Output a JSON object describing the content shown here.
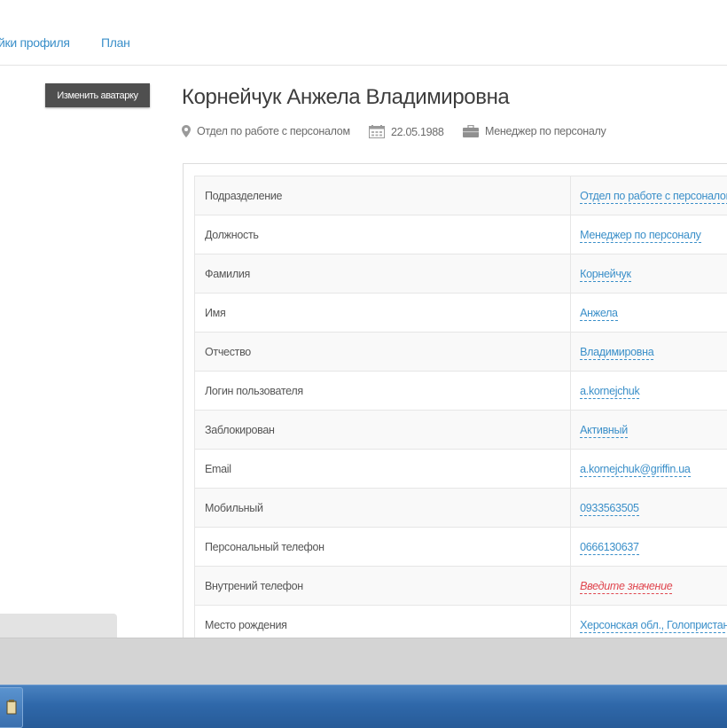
{
  "tabs": [
    "йки профиля",
    "План"
  ],
  "avatar_button": "Изменить аватарку",
  "profile": {
    "name": "Корнейчук Анжела Владимировна",
    "department": "Отдел по работе с персоналом",
    "birthdate": "22.05.1988",
    "position": "Менеджер по персоналу"
  },
  "icons": {
    "department": "map-marker-icon",
    "birthdate": "calendar-icon",
    "position": "briefcase-icon"
  },
  "colors": {
    "link": "#3a8fc9",
    "empty_value": "#e0464f",
    "button_bg": "#4f4f4f",
    "taskbar": "#2f68aa"
  },
  "fields": [
    {
      "label": "Подразделение",
      "value": "Отдел по работе с персоналом"
    },
    {
      "label": "Должность",
      "value": "Менеджер по персоналу"
    },
    {
      "label": "Фамилия",
      "value": "Корнейчук"
    },
    {
      "label": "Имя",
      "value": "Анжела"
    },
    {
      "label": "Отчество",
      "value": "Владимировна"
    },
    {
      "label": "Логин пользователя",
      "value": "a.kornejchuk"
    },
    {
      "label": "Заблокирован",
      "value": "Активный"
    },
    {
      "label": "Email",
      "value": "a.kornejchuk@griffin.ua"
    },
    {
      "label": "Мобильный",
      "value": "0933563505"
    },
    {
      "label": "Персональный телефон",
      "value": "0666130637"
    },
    {
      "label": "Внутрений телефон",
      "value": "Введите значение"
    },
    {
      "label": "Место рождения",
      "value": "Херсонская обл., Голопристанс"
    }
  ]
}
